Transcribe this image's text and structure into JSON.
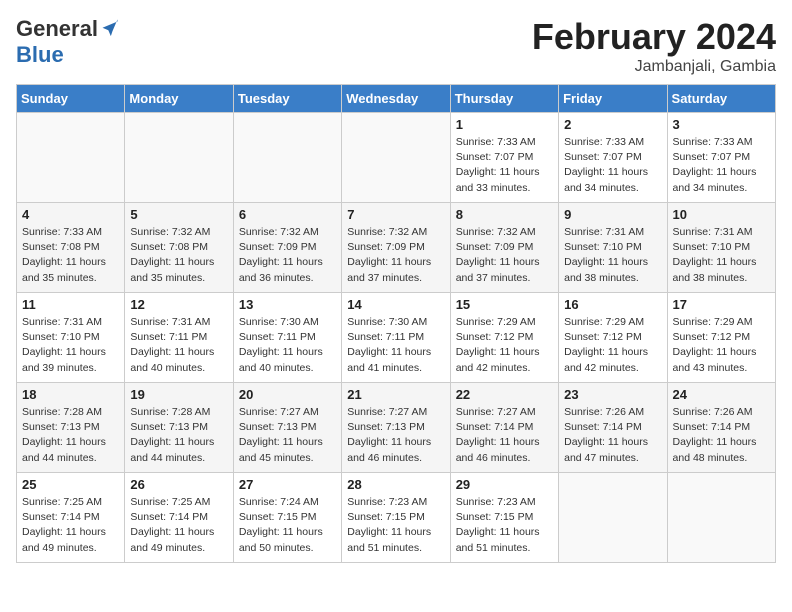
{
  "header": {
    "logo_general": "General",
    "logo_blue": "Blue",
    "month_title": "February 2024",
    "location": "Jambanjali, Gambia"
  },
  "days_of_week": [
    "Sunday",
    "Monday",
    "Tuesday",
    "Wednesday",
    "Thursday",
    "Friday",
    "Saturday"
  ],
  "weeks": [
    [
      {
        "day": "",
        "info": ""
      },
      {
        "day": "",
        "info": ""
      },
      {
        "day": "",
        "info": ""
      },
      {
        "day": "",
        "info": ""
      },
      {
        "day": "1",
        "info": "Sunrise: 7:33 AM\nSunset: 7:07 PM\nDaylight: 11 hours\nand 33 minutes."
      },
      {
        "day": "2",
        "info": "Sunrise: 7:33 AM\nSunset: 7:07 PM\nDaylight: 11 hours\nand 34 minutes."
      },
      {
        "day": "3",
        "info": "Sunrise: 7:33 AM\nSunset: 7:07 PM\nDaylight: 11 hours\nand 34 minutes."
      }
    ],
    [
      {
        "day": "4",
        "info": "Sunrise: 7:33 AM\nSunset: 7:08 PM\nDaylight: 11 hours\nand 35 minutes."
      },
      {
        "day": "5",
        "info": "Sunrise: 7:32 AM\nSunset: 7:08 PM\nDaylight: 11 hours\nand 35 minutes."
      },
      {
        "day": "6",
        "info": "Sunrise: 7:32 AM\nSunset: 7:09 PM\nDaylight: 11 hours\nand 36 minutes."
      },
      {
        "day": "7",
        "info": "Sunrise: 7:32 AM\nSunset: 7:09 PM\nDaylight: 11 hours\nand 37 minutes."
      },
      {
        "day": "8",
        "info": "Sunrise: 7:32 AM\nSunset: 7:09 PM\nDaylight: 11 hours\nand 37 minutes."
      },
      {
        "day": "9",
        "info": "Sunrise: 7:31 AM\nSunset: 7:10 PM\nDaylight: 11 hours\nand 38 minutes."
      },
      {
        "day": "10",
        "info": "Sunrise: 7:31 AM\nSunset: 7:10 PM\nDaylight: 11 hours\nand 38 minutes."
      }
    ],
    [
      {
        "day": "11",
        "info": "Sunrise: 7:31 AM\nSunset: 7:10 PM\nDaylight: 11 hours\nand 39 minutes."
      },
      {
        "day": "12",
        "info": "Sunrise: 7:31 AM\nSunset: 7:11 PM\nDaylight: 11 hours\nand 40 minutes."
      },
      {
        "day": "13",
        "info": "Sunrise: 7:30 AM\nSunset: 7:11 PM\nDaylight: 11 hours\nand 40 minutes."
      },
      {
        "day": "14",
        "info": "Sunrise: 7:30 AM\nSunset: 7:11 PM\nDaylight: 11 hours\nand 41 minutes."
      },
      {
        "day": "15",
        "info": "Sunrise: 7:29 AM\nSunset: 7:12 PM\nDaylight: 11 hours\nand 42 minutes."
      },
      {
        "day": "16",
        "info": "Sunrise: 7:29 AM\nSunset: 7:12 PM\nDaylight: 11 hours\nand 42 minutes."
      },
      {
        "day": "17",
        "info": "Sunrise: 7:29 AM\nSunset: 7:12 PM\nDaylight: 11 hours\nand 43 minutes."
      }
    ],
    [
      {
        "day": "18",
        "info": "Sunrise: 7:28 AM\nSunset: 7:13 PM\nDaylight: 11 hours\nand 44 minutes."
      },
      {
        "day": "19",
        "info": "Sunrise: 7:28 AM\nSunset: 7:13 PM\nDaylight: 11 hours\nand 44 minutes."
      },
      {
        "day": "20",
        "info": "Sunrise: 7:27 AM\nSunset: 7:13 PM\nDaylight: 11 hours\nand 45 minutes."
      },
      {
        "day": "21",
        "info": "Sunrise: 7:27 AM\nSunset: 7:13 PM\nDaylight: 11 hours\nand 46 minutes."
      },
      {
        "day": "22",
        "info": "Sunrise: 7:27 AM\nSunset: 7:14 PM\nDaylight: 11 hours\nand 46 minutes."
      },
      {
        "day": "23",
        "info": "Sunrise: 7:26 AM\nSunset: 7:14 PM\nDaylight: 11 hours\nand 47 minutes."
      },
      {
        "day": "24",
        "info": "Sunrise: 7:26 AM\nSunset: 7:14 PM\nDaylight: 11 hours\nand 48 minutes."
      }
    ],
    [
      {
        "day": "25",
        "info": "Sunrise: 7:25 AM\nSunset: 7:14 PM\nDaylight: 11 hours\nand 49 minutes."
      },
      {
        "day": "26",
        "info": "Sunrise: 7:25 AM\nSunset: 7:14 PM\nDaylight: 11 hours\nand 49 minutes."
      },
      {
        "day": "27",
        "info": "Sunrise: 7:24 AM\nSunset: 7:15 PM\nDaylight: 11 hours\nand 50 minutes."
      },
      {
        "day": "28",
        "info": "Sunrise: 7:23 AM\nSunset: 7:15 PM\nDaylight: 11 hours\nand 51 minutes."
      },
      {
        "day": "29",
        "info": "Sunrise: 7:23 AM\nSunset: 7:15 PM\nDaylight: 11 hours\nand 51 minutes."
      },
      {
        "day": "",
        "info": ""
      },
      {
        "day": "",
        "info": ""
      }
    ]
  ]
}
